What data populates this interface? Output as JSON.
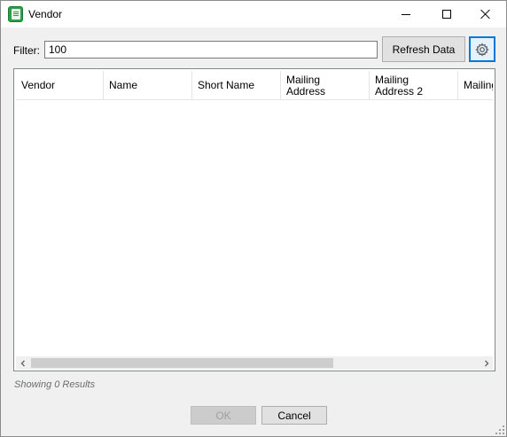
{
  "window": {
    "title": "Vendor"
  },
  "icons": {
    "app": "spreadsheet-doc-icon",
    "minimize": "minimize-icon",
    "maximize": "maximize-icon",
    "close": "close-icon",
    "settings": "gear-icon",
    "scroll_left": "chevron-left-icon",
    "scroll_right": "chevron-right-icon",
    "resize": "resize-grip-icon"
  },
  "filter": {
    "label": "Filter:",
    "value": "100"
  },
  "toolbar": {
    "refresh_label": "Refresh Data"
  },
  "grid": {
    "columns": [
      "Vendor",
      "Name",
      "Short Name",
      "Mailing\nAddress",
      "Mailing\nAddress 2",
      "Mailing"
    ],
    "rows": []
  },
  "status": {
    "text": "Showing 0 Results"
  },
  "buttons": {
    "ok_label": "OK",
    "cancel_label": "Cancel"
  },
  "colors": {
    "accent": "#0078d7",
    "app_icon": "#2e9e4a"
  }
}
